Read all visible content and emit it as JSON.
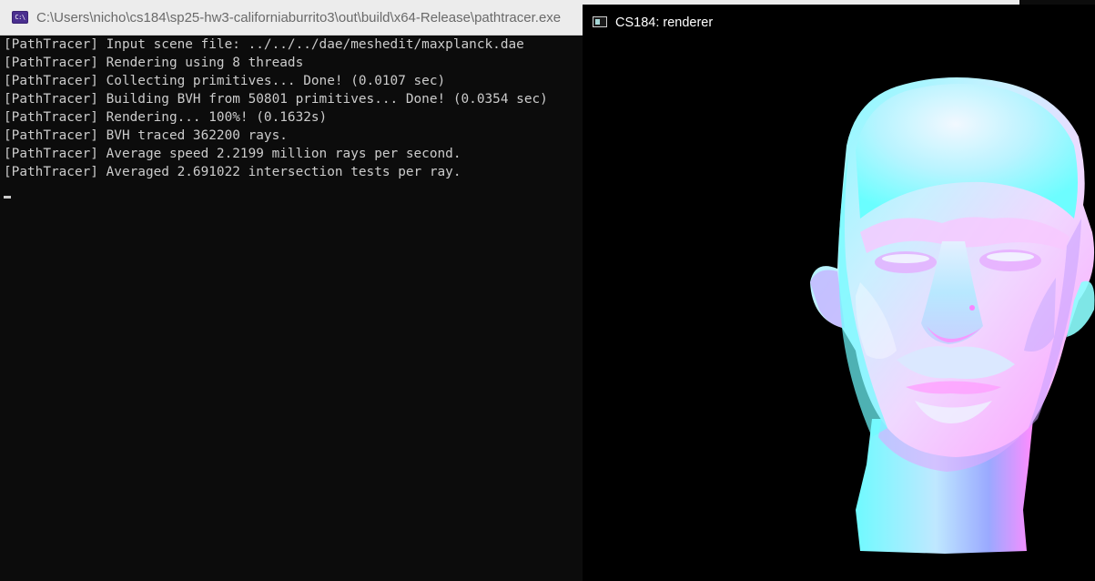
{
  "console": {
    "title": "C:\\Users\\nicho\\cs184\\sp25-hw3-californiaburrito3\\out\\build\\x64-Release\\pathtracer.exe",
    "icon_text": "C:\\",
    "icon": "console-app-icon",
    "lines": [
      "[PathTracer] Input scene file: ../../../dae/meshedit/maxplanck.dae",
      "[PathTracer] Rendering using 8 threads",
      "[PathTracer] Collecting primitives... Done! (0.0107 sec)",
      "[PathTracer] Building BVH from 50801 primitives... Done! (0.0354 sec)",
      "[PathTracer] Rendering... 100%! (0.1632s)",
      "[PathTracer] BVH traced 362200 rays.",
      "[PathTracer] Average speed 2.2199 million rays per second.",
      "[PathTracer] Averaged 2.691022 intersection tests per ray."
    ]
  },
  "renderer": {
    "title": "CS184: renderer",
    "icon": "window-app-icon",
    "render": "normal-shaded max planck bust"
  },
  "colors": {
    "console_bg": "#0c0c0c",
    "console_text": "#cccccc",
    "renderer_bg": "#000000",
    "normal_cyan": "#7fffff",
    "normal_magenta": "#ff66ff",
    "normal_white": "#e8f4ff",
    "normal_blue": "#8aa0ff"
  }
}
